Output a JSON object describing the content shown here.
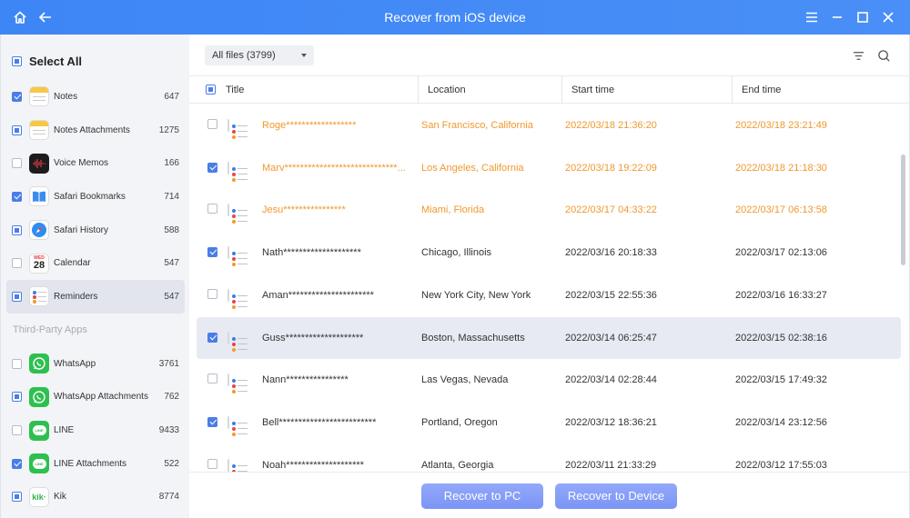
{
  "window": {
    "title": "Recover from iOS device"
  },
  "sidebar": {
    "select_all_label": "Select All",
    "section_third_party": "Third-Party Apps",
    "items": [
      {
        "label": "Notes",
        "count": "647",
        "state": "checked",
        "icon": "notes-icon"
      },
      {
        "label": "Notes Attachments",
        "count": "1275",
        "state": "partial",
        "icon": "notes-attachments-icon"
      },
      {
        "label": "Voice Memos",
        "count": "166",
        "state": "unchecked",
        "icon": "voice-memos-icon"
      },
      {
        "label": "Safari Bookmarks",
        "count": "714",
        "state": "checked",
        "icon": "safari-bookmarks-icon"
      },
      {
        "label": "Safari History",
        "count": "588",
        "state": "partial",
        "icon": "safari-icon"
      },
      {
        "label": "Calendar",
        "count": "547",
        "state": "unchecked",
        "icon": "calendar-icon",
        "calendar_month": "WED",
        "calendar_day": "28"
      },
      {
        "label": "Reminders",
        "count": "547",
        "state": "partial",
        "icon": "reminders-icon",
        "active": true
      }
    ],
    "third_party_items": [
      {
        "label": "WhatsApp",
        "count": "3761",
        "state": "unchecked",
        "icon": "whatsapp-icon"
      },
      {
        "label": "WhatsApp Attachments",
        "count": "762",
        "state": "partial",
        "icon": "whatsapp-icon"
      },
      {
        "label": "LINE",
        "count": "9433",
        "state": "unchecked",
        "icon": "line-icon"
      },
      {
        "label": "LINE Attachments",
        "count": "522",
        "state": "checked",
        "icon": "line-icon"
      },
      {
        "label": "Kik",
        "count": "8774",
        "state": "partial",
        "icon": "kik-icon"
      }
    ]
  },
  "toolbar": {
    "filter_value": "All files (3799)"
  },
  "table": {
    "columns": [
      "Title",
      "Location",
      "Start time",
      "End time"
    ],
    "rows": [
      {
        "title": "Roge******************",
        "location": "San Francisco, California",
        "start": "2022/03/18 21:36:20",
        "end": "2022/03/18 23:21:49",
        "checked": false,
        "deleted": true
      },
      {
        "title": "Marv*****************************...",
        "location": "Los Angeles, California",
        "start": "2022/03/18 19:22:09",
        "end": "2022/03/18 21:18:30",
        "checked": true,
        "deleted": true
      },
      {
        "title": "Jesu****************",
        "location": "Miami, Florida",
        "start": "2022/03/17 04:33:22",
        "end": "2022/03/17 06:13:58",
        "checked": false,
        "deleted": true
      },
      {
        "title": "Nath********************",
        "location": "Chicago, Illinois",
        "start": "2022/03/16 20:18:33",
        "end": "2022/03/17 02:13:06",
        "checked": true,
        "deleted": false
      },
      {
        "title": "Aman**********************",
        "location": "New York City, New York",
        "start": "2022/03/15 22:55:36",
        "end": "2022/03/16 16:33:27",
        "checked": false,
        "deleted": false
      },
      {
        "title": "Guss********************",
        "location": "Boston, Massachusetts",
        "start": "2022/03/14 06:25:47",
        "end": "2022/03/15 02:38:16",
        "checked": true,
        "deleted": false,
        "selected": true
      },
      {
        "title": "Nann****************",
        "location": "Las Vegas, Nevada",
        "start": "2022/03/14 02:28:44",
        "end": "2022/03/15 17:49:32",
        "checked": false,
        "deleted": false
      },
      {
        "title": "Bell*************************",
        "location": "Portland, Oregon",
        "start": "2022/03/12 18:36:21",
        "end": "2022/03/14 23:12:56",
        "checked": true,
        "deleted": false
      },
      {
        "title": "Noah********************",
        "location": "Atlanta, Georgia",
        "start": "2022/03/11 21:33:29",
        "end": "2022/03/12 17:55:03",
        "checked": false,
        "deleted": false
      }
    ]
  },
  "footer": {
    "recover_pc_label": "Recover to PC",
    "recover_device_label": "Recover to Device"
  },
  "colors": {
    "accent": "#3d86f5",
    "deleted_text": "#f0982e",
    "button": "#7b95f5"
  }
}
